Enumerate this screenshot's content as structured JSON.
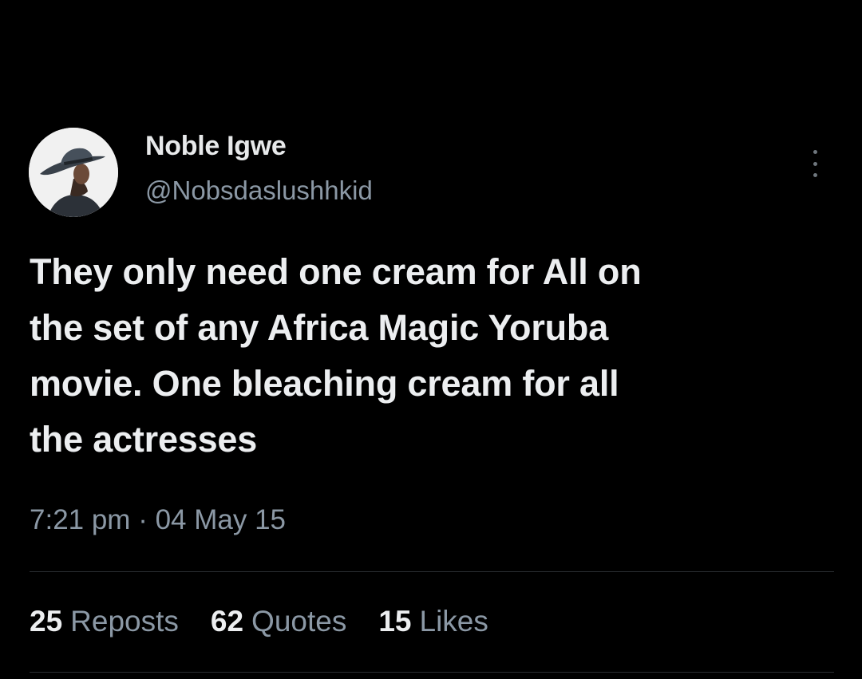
{
  "author": {
    "display_name": "Noble Igwe",
    "handle": "@Nobsdaslushhkid",
    "avatar_icon": "profile-photo-man-in-hat"
  },
  "tweet": {
    "text_lines": [
      "They only need one cream for All on",
      "the set of any Africa Magic Yoruba",
      "movie. One bleaching cream for all",
      "the actresses"
    ],
    "timestamp": "7:21 pm · 04 May 15"
  },
  "stats": {
    "reposts": {
      "count": "25",
      "label": "Reposts"
    },
    "quotes": {
      "count": "62",
      "label": "Quotes"
    },
    "likes": {
      "count": "15",
      "label": "Likes"
    }
  },
  "icons": {
    "more": "more-vertical-icon"
  },
  "colors": {
    "background": "#000000",
    "primary_text": "#e7e9ea",
    "secondary_text": "#8b98a5",
    "divider": "#2a2d31"
  }
}
